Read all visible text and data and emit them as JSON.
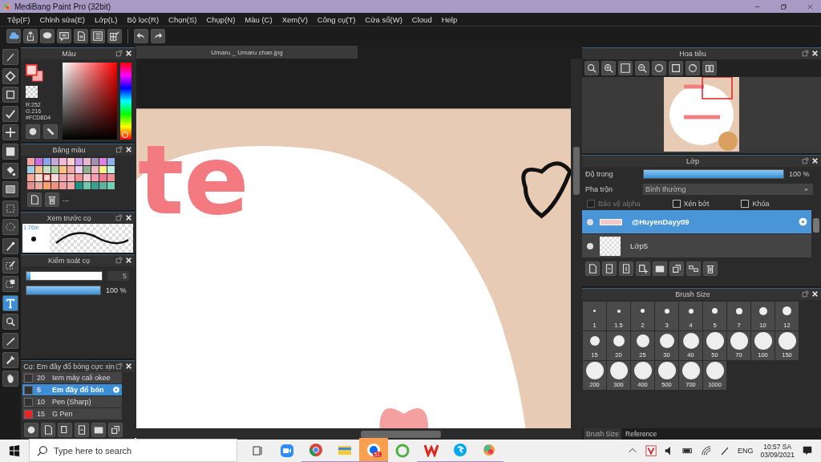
{
  "window": {
    "title": "MediBang Paint Pro (32bit)"
  },
  "menu": [
    "Tệp(F)",
    "Chỉnh sửa(E)",
    "Lớp(L)",
    "Bộ lọc(R)",
    "Chọn(S)",
    "Chụp(N)",
    "Màu (C)",
    "Xem(V)",
    "Công cụ(T)",
    "Cửa sổ(W)",
    "Cloud",
    "Help"
  ],
  "tools": [
    {
      "kind": "brush",
      "selected": false
    },
    {
      "kind": "eraser",
      "selected": false
    },
    {
      "kind": "rect",
      "selected": false
    },
    {
      "kind": "check",
      "selected": false
    },
    {
      "kind": "move",
      "selected": false
    },
    {
      "kind": "fill",
      "selected": false
    },
    {
      "kind": "bucket",
      "selected": false
    },
    {
      "kind": "gradient",
      "selected": false
    },
    {
      "kind": "select",
      "selected": false
    },
    {
      "kind": "lasso",
      "selected": false
    },
    {
      "kind": "wand",
      "selected": false
    },
    {
      "kind": "selpen",
      "selected": false
    },
    {
      "kind": "selerase",
      "selected": false
    },
    {
      "kind": "text",
      "selected": true
    },
    {
      "kind": "operation",
      "selected": false
    },
    {
      "kind": "divide",
      "selected": false
    },
    {
      "kind": "dropper",
      "selected": false
    },
    {
      "kind": "hand",
      "selected": false
    }
  ],
  "color_panel": {
    "title": "Màu",
    "r": "R:252",
    "g": "G:216",
    "hex": "#FCD8D4",
    "hue": {
      "level": 0
    }
  },
  "palette": {
    "title": "Bảng màu",
    "name": "---",
    "swatches": [
      {
        "color": "#f4a6a6",
        "selected": false
      },
      {
        "color": "#c86ee0",
        "selected": false
      },
      {
        "color": "#8aa4e8",
        "selected": false
      },
      {
        "color": "#c8a8d8",
        "selected": false
      },
      {
        "color": "#f4b8d8",
        "selected": false
      },
      {
        "color": "#f8d0d0",
        "selected": false
      },
      {
        "color": "#c8a0e8",
        "selected": false
      },
      {
        "color": "#e8b8d0",
        "selected": false
      },
      {
        "color": "#a090b0",
        "selected": false
      },
      {
        "color": "#e080e0",
        "selected": false
      },
      {
        "color": "#90b0e8",
        "selected": false
      },
      {
        "color": "#a0d0e8",
        "selected": false
      },
      {
        "color": "#f8c090",
        "selected": false
      },
      {
        "color": "#c0e0c0",
        "selected": false
      },
      {
        "color": "#b0d0a0",
        "selected": false
      },
      {
        "color": "#f8c080",
        "selected": false
      },
      {
        "color": "#f8a8a8",
        "selected": false
      },
      {
        "color": "#f0d0f0",
        "selected": false
      },
      {
        "color": "#90b090",
        "selected": false
      },
      {
        "color": "#f0b8c0",
        "selected": false
      },
      {
        "color": "#f8f080",
        "selected": false
      },
      {
        "color": "#c0f0e0",
        "selected": false
      },
      {
        "color": "#f8a898",
        "selected": false
      },
      {
        "color": "#f8d8c8",
        "selected": false
      },
      {
        "color": "#fcd8d4",
        "selected": true
      },
      {
        "color": "#f8d8d8",
        "selected": false
      },
      {
        "color": "#f8a8b0",
        "selected": false
      },
      {
        "color": "#f8b8c0",
        "selected": false
      },
      {
        "color": "#f09090",
        "selected": false
      },
      {
        "color": "#f8c8d0",
        "selected": false
      },
      {
        "color": "#f8a0b0",
        "selected": false
      },
      {
        "color": "#f07890",
        "selected": false
      },
      {
        "color": "#f09098",
        "selected": false
      },
      {
        "color": "#e09090",
        "selected": false
      },
      {
        "color": "#e8a8a0",
        "selected": false
      },
      {
        "color": "#f8a070",
        "selected": false
      },
      {
        "color": "#f09080",
        "selected": false
      },
      {
        "color": "#f0a0a0",
        "selected": false
      },
      {
        "color": "#f8a8a8",
        "selected": false
      },
      {
        "color": "#209080",
        "selected": false
      },
      {
        "color": "#70c8a8",
        "selected": false
      },
      {
        "color": "#40a090",
        "selected": false
      },
      {
        "color": "#60b0a0",
        "selected": false
      },
      {
        "color": "#70d0b0",
        "selected": false
      }
    ]
  },
  "brush_preview": {
    "title": "Xem trước cọ",
    "size": "1.76m"
  },
  "brush_control": {
    "title": "Kiểm soát cọ",
    "size": {
      "level": 0.05,
      "value": "5"
    },
    "opacity": {
      "level": 1,
      "value": "100 %"
    }
  },
  "brush_list": {
    "title": "Cọ: Em đây đổ bóng cực xịn",
    "items": [
      {
        "size": "20",
        "name": "Iem mày cali okee",
        "color": "#333333",
        "selected": false
      },
      {
        "size": "5",
        "name": "Em đây đổ bón",
        "color": "#333333",
        "selected": true
      },
      {
        "size": "10",
        "name": "Pen (Sharp)",
        "color": "#333333",
        "selected": false
      },
      {
        "size": "15",
        "name": "G Pen",
        "color": "#ee2222",
        "selected": false
      }
    ]
  },
  "document": {
    "tab": "Umaru _ Umaru chan.jpg",
    "canvas_text": "te"
  },
  "navigator": {
    "title": "Hoa tiêu"
  },
  "layers": {
    "title": "Lớp",
    "opacity_label": "Độ trong",
    "opacity": {
      "level": 1,
      "value": "100 %"
    },
    "blend_label": "Pha trộn",
    "blend_value": "Bình thường",
    "options": [
      {
        "label": "Bảo vệ alpha",
        "checked": false,
        "disabled": true
      },
      {
        "label": "Xén bớt",
        "checked": false,
        "disabled": false
      },
      {
        "label": "Khóa",
        "checked": false,
        "disabled": false
      }
    ],
    "items": [
      {
        "name": "@HuyenDayy09",
        "selected": true
      },
      {
        "name": "Lớp5",
        "selected": false
      }
    ]
  },
  "brush_size": {
    "title": "Brush Size",
    "sizes": [
      "1",
      "1.5",
      "2",
      "3",
      "4",
      "5",
      "7",
      "10",
      "12",
      "15",
      "20",
      "25",
      "30",
      "40",
      "50",
      "70",
      "100",
      "150",
      "200",
      "300",
      "400",
      "500",
      "700",
      "1000"
    ]
  },
  "bottom_tabs": [
    {
      "label": "Brush Size",
      "selected": true
    },
    {
      "label": "Reference",
      "selected": false
    }
  ],
  "taskbar": {
    "search_placeholder": "Type here to search",
    "apps": [
      {
        "kind": "taskview",
        "running": false,
        "active": false
      },
      {
        "kind": "video",
        "running": false,
        "active": false
      },
      {
        "kind": "browser",
        "running": true,
        "active": false
      },
      {
        "kind": "folder",
        "running": true,
        "active": false
      },
      {
        "kind": "chat",
        "running": true,
        "active": true,
        "badge": "51"
      },
      {
        "kind": "leaf",
        "running": false,
        "active": false
      },
      {
        "kind": "office",
        "running": true,
        "active": false
      },
      {
        "kind": "phone",
        "running": true,
        "active": false
      },
      {
        "kind": "paint",
        "running": true,
        "active": false
      }
    ],
    "language": "ENG",
    "time": "10:57 SA",
    "date": "03/09/2021"
  }
}
